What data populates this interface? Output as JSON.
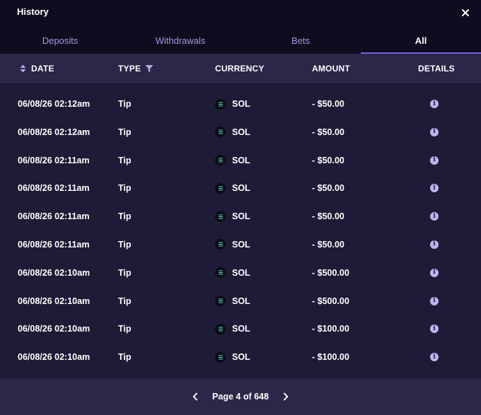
{
  "window": {
    "title": "History"
  },
  "tabs": [
    {
      "label": "Deposits",
      "active": false
    },
    {
      "label": "Withdrawals",
      "active": false
    },
    {
      "label": "Bets",
      "active": false
    },
    {
      "label": "All",
      "active": true
    }
  ],
  "columns": {
    "date": "DATE",
    "type": "TYPE",
    "currency": "CURRENCY",
    "amount": "AMOUNT",
    "details": "DETAILS"
  },
  "rows": [
    {
      "date": "06/08/26 02:12am",
      "type": "Tip",
      "currency": "SOL",
      "amount": "- $50.00"
    },
    {
      "date": "06/08/26 02:12am",
      "type": "Tip",
      "currency": "SOL",
      "amount": "- $50.00"
    },
    {
      "date": "06/08/26 02:11am",
      "type": "Tip",
      "currency": "SOL",
      "amount": "- $50.00"
    },
    {
      "date": "06/08/26 02:11am",
      "type": "Tip",
      "currency": "SOL",
      "amount": "- $50.00"
    },
    {
      "date": "06/08/26 02:11am",
      "type": "Tip",
      "currency": "SOL",
      "amount": "- $50.00"
    },
    {
      "date": "06/08/26 02:11am",
      "type": "Tip",
      "currency": "SOL",
      "amount": "- $50.00"
    },
    {
      "date": "06/08/26 02:10am",
      "type": "Tip",
      "currency": "SOL",
      "amount": "- $500.00"
    },
    {
      "date": "06/08/26 02:10am",
      "type": "Tip",
      "currency": "SOL",
      "amount": "- $500.00"
    },
    {
      "date": "06/08/26 02:10am",
      "type": "Tip",
      "currency": "SOL",
      "amount": "- $100.00"
    },
    {
      "date": "06/08/26 02:10am",
      "type": "Tip",
      "currency": "SOL",
      "amount": "- $100.00"
    }
  ],
  "pagination": {
    "label": "Page 4 of 648"
  },
  "icons": {
    "close": "close-icon",
    "sort": "sort-icon",
    "filter": "filter-icon",
    "currency": "solana-icon",
    "details": "info-icon",
    "prev": "chevron-left-icon",
    "next": "chevron-right-icon"
  },
  "colors": {
    "background": "#1d1b36",
    "header_bg": "#0e0d1f",
    "table_header_bg": "#2a2748",
    "accent": "#7b5ce0",
    "tab_inactive": "#a796e2",
    "info_icon": "#bfb2ef"
  }
}
